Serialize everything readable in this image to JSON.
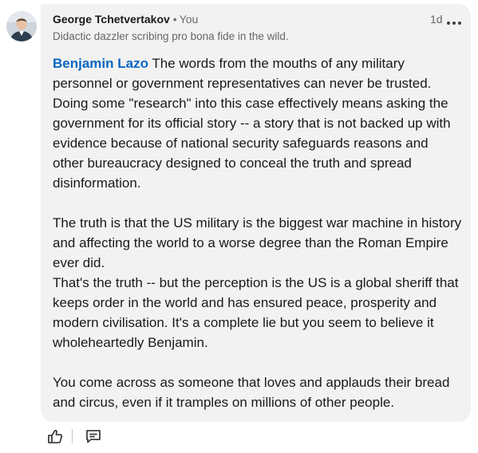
{
  "comment": {
    "author": {
      "name": "George Tchetvertakov",
      "separator": "•",
      "degree": "You",
      "headline": "Didactic dazzler scribing pro bona fide in the wild.",
      "avatar": "profile-photo"
    },
    "timestamp": "1d",
    "more_icon": "ellipsis-icon",
    "mention": "Benjamin Lazo",
    "paragraph1": " The words from the mouths of any military personnel or government representatives can never be trusted. Doing some \"research\" into this case effectively means asking the government for its official story -- a story that is not backed up with evidence because of national security safeguards reasons and other bureaucracy designed to conceal the truth and spread disinformation.",
    "paragraph2": "The truth is that the US military is the biggest war machine in history and affecting the world to a worse degree than the Roman Empire ever did.",
    "paragraph3": "That's the truth -- but the perception is the US is a global sheriff that keeps order in the world and has ensured peace, prosperity and modern civilisation. It's a complete lie but you seem to believe it wholeheartedly Benjamin.",
    "paragraph4": "You come across as someone that loves and applauds their bread and circus, even if it tramples on millions of other people."
  },
  "actions": {
    "like_icon": "thumbs-up-icon",
    "reply_icon": "comment-icon"
  },
  "colors": {
    "bubble": "#f2f2f2",
    "mention": "#0a66c2",
    "text": "#191919",
    "secondary": "#666666"
  }
}
